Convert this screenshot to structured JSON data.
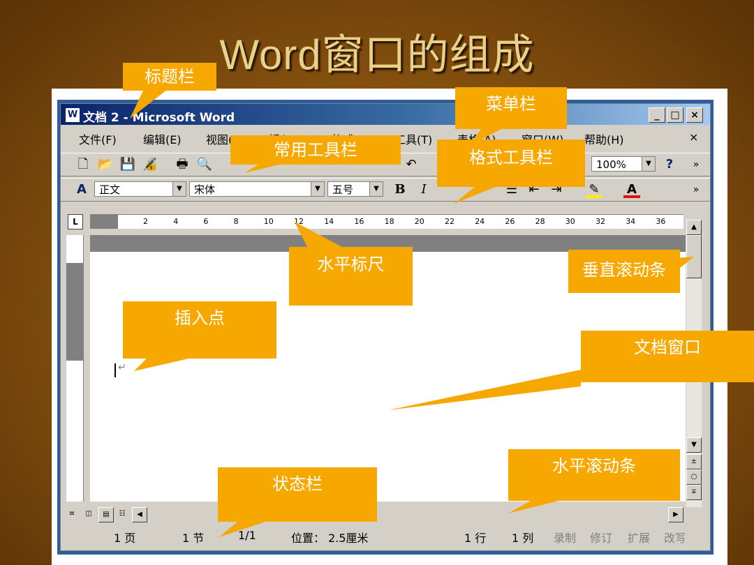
{
  "slide": {
    "title": "Word窗口的组成"
  },
  "window": {
    "title": "文档 2 - Microsoft Word",
    "buttons": [
      "_",
      "□",
      "×"
    ]
  },
  "menubar": {
    "items": [
      "文件(F)",
      "编辑(E)",
      "视图(V)",
      "插入(I)",
      "格式(O)",
      "工具(T)",
      "表格(A)",
      "窗口(W)",
      "帮助(H)"
    ],
    "close": "×"
  },
  "toolbar_standard": {
    "zoom": "100%",
    "help": "?"
  },
  "toolbar_format": {
    "style": "正文",
    "font": "宋体",
    "size": "五号",
    "bold": "B",
    "italic": "I"
  },
  "ruler": {
    "ticks": [
      "2",
      "4",
      "6",
      "8",
      "10",
      "12",
      "14",
      "16",
      "18",
      "20",
      "22",
      "24",
      "26",
      "28",
      "30",
      "32",
      "34",
      "36"
    ]
  },
  "statusbar": {
    "page": "1 页",
    "section": "1 节",
    "pages": "1/1",
    "position": "位置： 2.5厘米",
    "line": "1 行",
    "column": "1 列",
    "rec": "录制",
    "trk": "修订",
    "ext": "扩展",
    "ovr": "改写"
  },
  "callouts": {
    "title_bar": "标题栏",
    "menu_bar": "菜单栏",
    "standard_toolbar": "常用工具栏",
    "format_toolbar": "格式工具栏",
    "horizontal_ruler": "水平标尺",
    "vertical_scrollbar": "垂直滚动条",
    "insertion_point": "插入点",
    "document_window": "文档窗口",
    "horizontal_scrollbar": "水平滚动条",
    "status_bar": "状态栏"
  },
  "colors": {
    "callout": "#f6a800",
    "titlebar": "#0a246a"
  }
}
